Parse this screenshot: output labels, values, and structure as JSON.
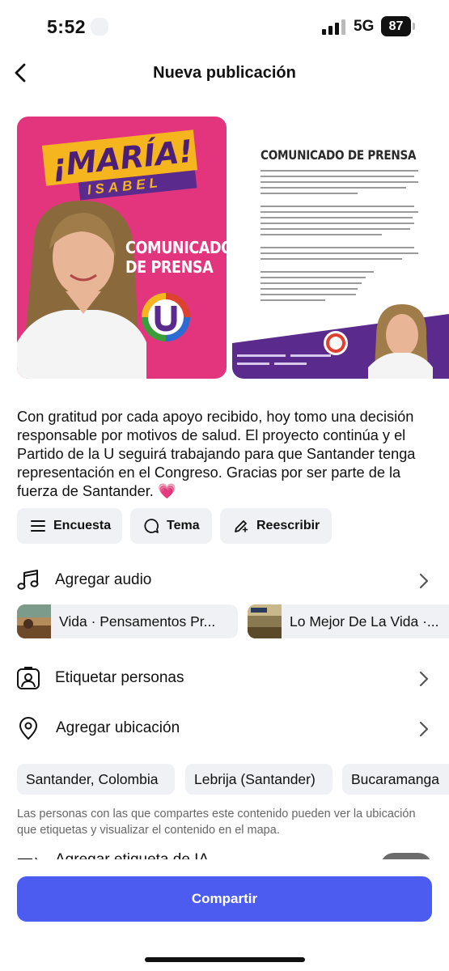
{
  "status_bar": {
    "time": "5:52",
    "network": "5G",
    "battery": "87"
  },
  "header": {
    "title": "Nueva publicación"
  },
  "media": {
    "image1": {
      "banner_line1": "¡MARÍA!",
      "banner_line2": "ISABEL",
      "headline_line1": "COMUNICADO",
      "headline_line2": "DE PRENSA"
    },
    "image2": {
      "title": "COMUNICADO DE PRENSA"
    }
  },
  "caption": {
    "text": "Con gratitud por cada apoyo recibido, hoy tomo una decisión responsable por motivos de salud. El proyecto continúa y el Partido de la U seguirá trabajando para que Santander tenga representación en el Congreso. Gracias por ser parte de la fuerza de Santander.",
    "emoji": "💗"
  },
  "chips": [
    {
      "label": "Encuesta",
      "icon": "list-icon"
    },
    {
      "label": "Tema",
      "icon": "speech-bubble-icon"
    },
    {
      "label": "Reescribir",
      "icon": "pencil-sparkle-icon"
    }
  ],
  "rows": {
    "audio": {
      "label": "Agregar audio",
      "icon": "music-note-icon"
    },
    "tag_people": {
      "label": "Etiquetar personas",
      "icon": "person-tag-icon"
    },
    "location": {
      "label": "Agregar ubicación",
      "icon": "location-pin-icon"
    },
    "ai_label": {
      "label": "Agregar etiqueta de IA"
    }
  },
  "audio_suggestions": [
    {
      "title": "Vida · Pensamentos Pr..."
    },
    {
      "title": "Lo Mejor De La Vida ·..."
    }
  ],
  "location_suggestions": [
    "Santander, Colombia",
    "Lebrija (Santander)",
    "Bucaramanga"
  ],
  "location_note": "Las personas con las que compartes este contenido pueden ver la ubicación que etiquetas y visualizar el contenido en el mapa.",
  "share_button": {
    "label": "Compartir"
  },
  "colors": {
    "accent": "#4d5cf0",
    "chip_bg": "#f0f1f4",
    "pink": "#e2357e",
    "purple": "#5a2a8c",
    "yellow": "#f4b51f"
  }
}
